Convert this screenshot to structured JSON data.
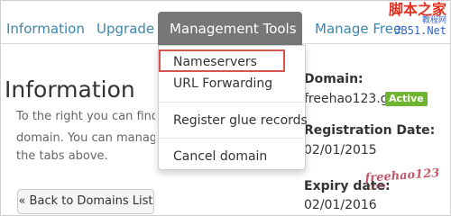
{
  "tabs": {
    "information": "Information",
    "upgrade": "Upgrade",
    "management_tools": "Management Tools",
    "manage_free": "Manage Free"
  },
  "page": {
    "title": "Information",
    "description_lines": [
      "To the right you can find the",
      "domain. You can manage",
      "the tabs above."
    ],
    "back_button": "« Back to Domains List"
  },
  "details": {
    "domain_label": "Domain:",
    "domain_value": "freehao123.gq",
    "status_badge": "Active",
    "registration_label": "Registration Date:",
    "registration_value": "02/01/2015",
    "expiry_label": "Expiry date:",
    "expiry_value": "02/01/2016"
  },
  "dropdown": {
    "items": [
      "Nameservers",
      "URL Forwarding",
      "Register glue records",
      "Cancel domain"
    ],
    "highlighted_item": "Nameservers"
  },
  "watermark": {
    "top_main": "脚本之家",
    "top_small": "教程网",
    "top_site": "JB51.Net",
    "bottom_main": "freehao123",
    "bottom_sub": ".com"
  },
  "colors": {
    "tab_link": "#3a87ad",
    "active_tab_bg": "#777777",
    "badge_active": "#70b531",
    "highlight_border": "#d9534f"
  },
  "icons": {
    "dropdown_caret": "caret-down-icon"
  }
}
